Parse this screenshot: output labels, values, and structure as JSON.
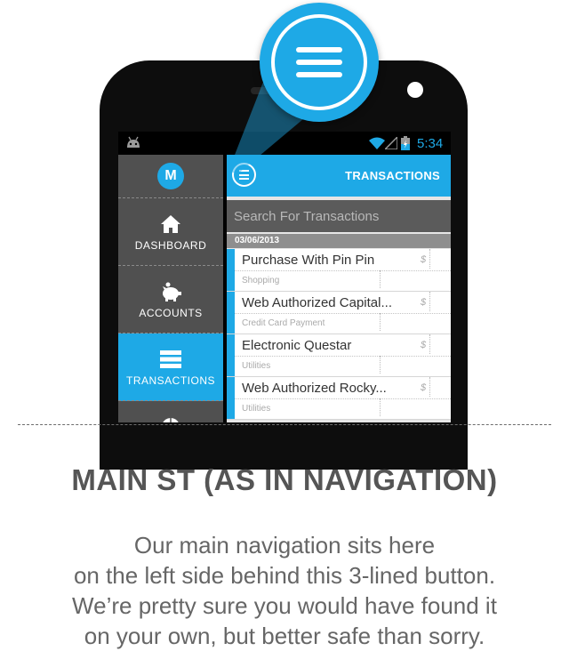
{
  "statusbar": {
    "time": "5:34"
  },
  "sidebar": {
    "logo": "M",
    "items": [
      {
        "label": "DASHBOARD",
        "icon": "home-icon"
      },
      {
        "label": "ACCOUNTS",
        "icon": "piggy-bank-icon"
      },
      {
        "label": "TRANSACTIONS",
        "icon": "list-icon",
        "active": true
      },
      {
        "label": "",
        "icon": "pie-chart-icon"
      }
    ]
  },
  "topbar": {
    "title": "TRANSACTIONS"
  },
  "search": {
    "placeholder": "Search For Transactions"
  },
  "date_header": "03/06/2013",
  "transactions": [
    {
      "name": "Purchase With Pin Pin",
      "currency": "$",
      "category": "Shopping"
    },
    {
      "name": "Web Authorized Capital...",
      "currency": "$",
      "category": "Credit Card Payment"
    },
    {
      "name": "Electronic Questar",
      "currency": "$",
      "category": "Utilities"
    },
    {
      "name": "Web Authorized Rocky...",
      "currency": "$",
      "category": "Utilities"
    }
  ],
  "caption": {
    "heading": "MAIN ST (AS IN NAVIGATION)",
    "lines": [
      "Our main navigation sits here",
      "on the left side behind this 3-lined button.",
      "We’re pretty sure you would have found it",
      "on your own, but better safe than sorry."
    ]
  },
  "colors": {
    "accent": "#1ea9e6",
    "sidebar": "#505050",
    "text": "#555555"
  }
}
